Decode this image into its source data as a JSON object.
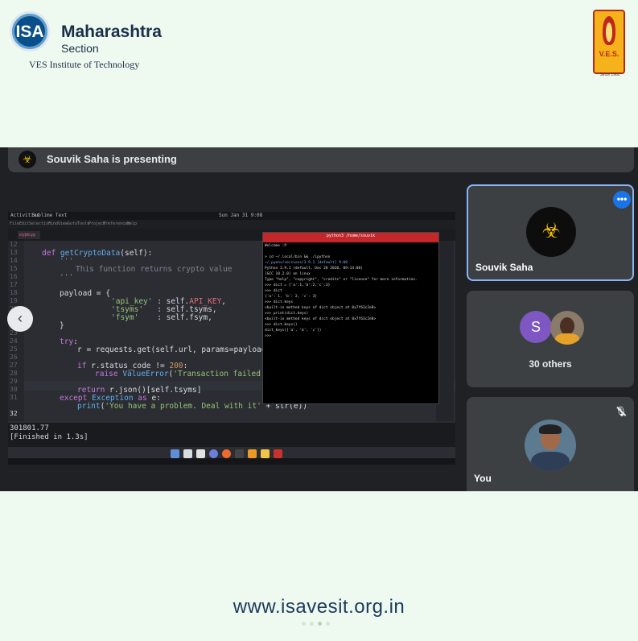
{
  "header": {
    "org_logo_text": "ISA",
    "org_title": "Maharashtra",
    "org_subtitle": "Section",
    "institute": "VES Institute of Technology",
    "ves_logo_text": "V.E.S.",
    "ves_since": "Since 1962"
  },
  "meet": {
    "presenting_text": "Souvik Saha is presenting",
    "tiles": [
      {
        "name": "Souvik Saha"
      },
      {
        "name": "30 others",
        "initial": "S"
      },
      {
        "name": "You"
      }
    ]
  },
  "screen": {
    "topbar_left": "Activities",
    "topbar_app": "Sublime Text",
    "topbar_clock": "Sun Jan 31 9:08",
    "menu": [
      "File",
      "Edit",
      "Selection",
      "Find",
      "View",
      "Goto",
      "Tools",
      "Project",
      "Preferences",
      "Help"
    ],
    "tab_label": "crypto.py",
    "line_numbers": [
      "12",
      "13",
      "14",
      "15",
      "16",
      "17",
      "18",
      "19",
      "20",
      "21",
      "22",
      "23",
      "24",
      "25",
      "26",
      "27",
      "28",
      "29",
      "30",
      "31",
      "32"
    ],
    "code_lines": [
      {
        "t": "def",
        "c": "kw"
      },
      {
        "t": "getCryptoData",
        "c": "fn"
      },
      {
        "t": "(self):",
        "c": ""
      },
      {
        "t": "'''",
        "c": "cm"
      },
      {
        "t": "This function returns crypto value",
        "c": "cm"
      },
      {
        "t": "'''",
        "c": "cm"
      },
      {
        "t": "payload = {",
        "c": ""
      },
      {
        "t": "'api_key'",
        "c": "st"
      },
      {
        "t": " : self.",
        "c": ""
      },
      {
        "t": "API_KEY",
        "c": "rd"
      },
      {
        "t": ",",
        "c": ""
      },
      {
        "t": "'tsyms'",
        "c": "st"
      },
      {
        "t": "   : self.tsyms,",
        "c": ""
      },
      {
        "t": "'fsym'",
        "c": "st"
      },
      {
        "t": "    : self.fsym,",
        "c": ""
      },
      {
        "t": "}",
        "c": ""
      },
      {
        "t": "try",
        "c": "kw"
      },
      {
        "t": ":",
        "c": ""
      },
      {
        "t": "r = requests.get(self.url, params=payload)",
        "c": ""
      },
      {
        "t": "if",
        "c": "kw"
      },
      {
        "t": " r.status_code != ",
        "c": ""
      },
      {
        "t": "200",
        "c": "nm"
      },
      {
        "t": ":",
        "c": ""
      },
      {
        "t": "raise",
        "c": "kw"
      },
      {
        "t": "ValueError",
        "c": "fn"
      },
      {
        "t": "(",
        "c": ""
      },
      {
        "t": "'Transaction failed'",
        "c": "st"
      },
      {
        "t": ")",
        "c": ""
      },
      {
        "t": "return",
        "c": "kw"
      },
      {
        "t": " r.json()[self.tsyms]",
        "c": ""
      },
      {
        "t": "except",
        "c": "kw"
      },
      {
        "t": "Exception",
        "c": "fn"
      },
      {
        "t": "as",
        "c": "kw"
      },
      {
        "t": " e:",
        "c": ""
      },
      {
        "t": "print",
        "c": "fn"
      },
      {
        "t": "(",
        "c": ""
      },
      {
        "t": "'You have a problem. Deal with it'",
        "c": "st"
      },
      {
        "t": " + str(e))",
        "c": ""
      }
    ],
    "console": [
      "301801.77",
      "[Finished in 1.3s]"
    ],
    "terminal_title": "python3 /home/souvik",
    "terminal_lines": [
      "Welcome :P",
      "",
      "> cd ~/.local/bin && ./ipython",
      "~/.pyenv/versions/3.9.1 [default] 9:08",
      "Python 3.9.1 (default, Dec 28 2020, 09:14:08)",
      "[GCC 10.2.0] on linux",
      "Type \"help\", \"copyright\", \"credits\" or \"license\" for more information.",
      ">>> dict = {'a':1,'b':2,'c':3}",
      ">>> dict",
      "{'a': 1, 'b': 2, 'c': 3}",
      ">>> dict.keys",
      "<built-in method keys of dict object at 0x7f63c2e8>",
      ">>> print(dict.keys)",
      "<built-in method keys of dict object at 0x7f63c2e8>",
      ">>> dict.keys()",
      "dict_keys(['a', 'b', 'c'])",
      ">>> "
    ]
  },
  "footer": {
    "url": "www.isavesit.org.in"
  },
  "icons": {
    "nav_left": "chevron-left-icon",
    "nav_right": "chevron-right-icon",
    "more": "more-options-icon",
    "mic_off": "mic-off-icon"
  },
  "colors": {
    "page_bg": "#eef9ef",
    "meet_bg": "#202124",
    "tile_bg": "#3c4043",
    "active_border": "#8ab4f8",
    "accent_blue": "#1a73e8",
    "avatar_purple": "#7e57c2",
    "terminal_titlebar": "#c3272b"
  }
}
